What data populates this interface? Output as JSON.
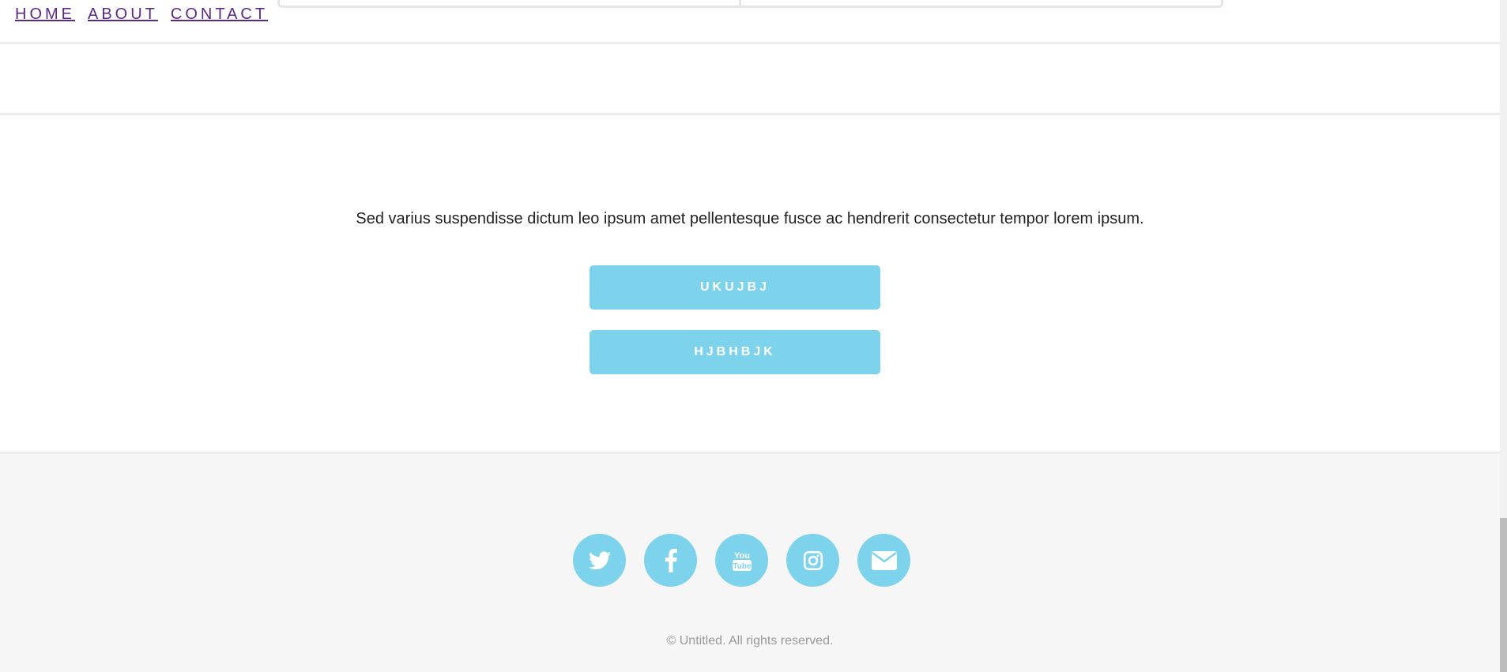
{
  "nav": {
    "items": [
      {
        "label": "HOME"
      },
      {
        "label": "ABOUT"
      },
      {
        "label": "CONTACT"
      }
    ]
  },
  "main": {
    "blurb": "Sed varius suspendisse dictum leo ipsum amet pellentesque fusce ac hendrerit consectetur tempor lorem ipsum.",
    "buttons": [
      {
        "label": "UKUJBJ"
      },
      {
        "label": "HJBHBJK"
      }
    ]
  },
  "footer": {
    "socials": [
      {
        "icon": "twitter-icon"
      },
      {
        "icon": "facebook-icon"
      },
      {
        "icon": "youtube-icon"
      },
      {
        "icon": "instagram-icon"
      },
      {
        "icon": "email-icon"
      }
    ],
    "copyright": "© Untitled. All rights reserved."
  },
  "colors": {
    "accent": "#7dd3ec",
    "link": "#5b2a86",
    "footer_bg": "#f6f6f6"
  }
}
